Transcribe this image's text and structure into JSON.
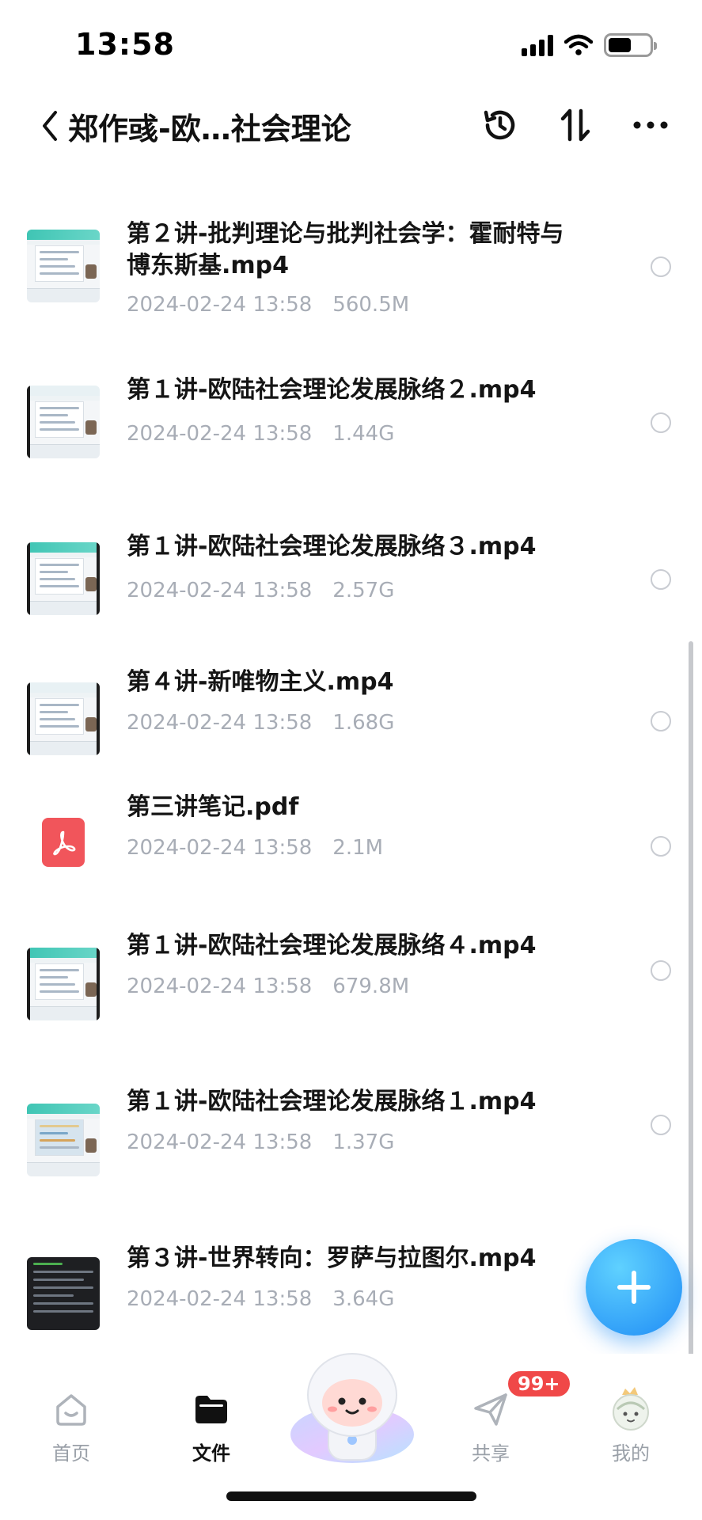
{
  "status": {
    "time": "13:58"
  },
  "header": {
    "title": "郑作彧-欧…社会理论"
  },
  "files": [
    {
      "name": "第２讲-批判理论与批判社会学：霍耐特与博东斯基.mp4",
      "date": "2024-02-24 13:58",
      "size": "560.5M",
      "thumb": "video"
    },
    {
      "name": "第１讲-欧陆社会理论发展脉络２.mp4",
      "date": "2024-02-24 13:58",
      "size": "1.44G",
      "thumb": "video"
    },
    {
      "name": "第１讲-欧陆社会理论发展脉络３.mp4",
      "date": "2024-02-24 13:58",
      "size": "2.57G",
      "thumb": "video"
    },
    {
      "name": "第４讲-新唯物主义.mp4",
      "date": "2024-02-24 13:58",
      "size": "1.68G",
      "thumb": "video"
    },
    {
      "name": "第三讲笔记.pdf",
      "date": "2024-02-24 13:58",
      "size": "2.1M",
      "thumb": "pdf"
    },
    {
      "name": "第１讲-欧陆社会理论发展脉络４.mp4",
      "date": "2024-02-24 13:58",
      "size": "679.8M",
      "thumb": "video"
    },
    {
      "name": "第１讲-欧陆社会理论发展脉络１.mp4",
      "date": "2024-02-24 13:58",
      "size": "1.37G",
      "thumb": "map"
    },
    {
      "name": "第３讲-世界转向：罗萨与拉图尔.mp4",
      "date": "2024-02-24 13:58",
      "size": "3.64G",
      "thumb": "code"
    }
  ],
  "tabbar": {
    "home": "首页",
    "files": "文件",
    "share": "共享",
    "mine": "我的",
    "share_badge": "99+"
  },
  "icons": [
    "back-icon",
    "history-icon",
    "sort-icon",
    "more-icon",
    "plus-icon",
    "home-icon",
    "folder-icon",
    "send-icon",
    "avatar-icon",
    "mascot-icon",
    "pdf-icon"
  ],
  "colors": {
    "accent": "#1f8cf5",
    "badge": "#f04848",
    "meta": "#a8adb6",
    "pdf": "#f1555b"
  }
}
